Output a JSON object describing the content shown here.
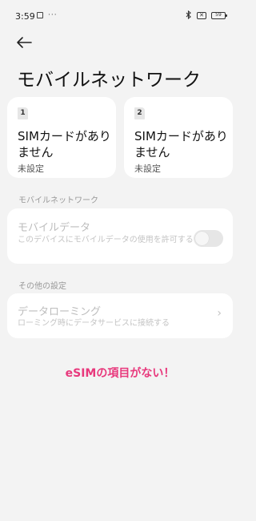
{
  "status_bar": {
    "time": "3:59",
    "left_icons": [
      "square-notification-icon",
      "more-dots-icon"
    ],
    "right_icons": [
      "bluetooth-icon",
      "no-sim-icon",
      "battery-icon"
    ],
    "no_sim_glyph": "✕",
    "battery_level": "59"
  },
  "header": {
    "back_icon": "arrow-left-icon",
    "title": "モバイルネットワーク"
  },
  "sim_cards": [
    {
      "slot": "1",
      "title": "SIMカードがありません",
      "status": "未設定"
    },
    {
      "slot": "2",
      "title": "SIMカードがありません",
      "status": "未設定"
    }
  ],
  "mobile_network_section": {
    "label": "モバイルネットワーク",
    "mobile_data": {
      "title": "モバイルデータ",
      "subtitle": "このデバイスにモバイルデータの使用を許可する",
      "enabled": false
    }
  },
  "other_settings_section": {
    "label": "その他の設定",
    "data_roaming": {
      "title": "データローミング",
      "subtitle": "ローミング時にデータサービスに接続する",
      "chevron": "›"
    }
  },
  "annotation": {
    "text": "eSIMの項目がない！",
    "color": "#e8387c"
  }
}
